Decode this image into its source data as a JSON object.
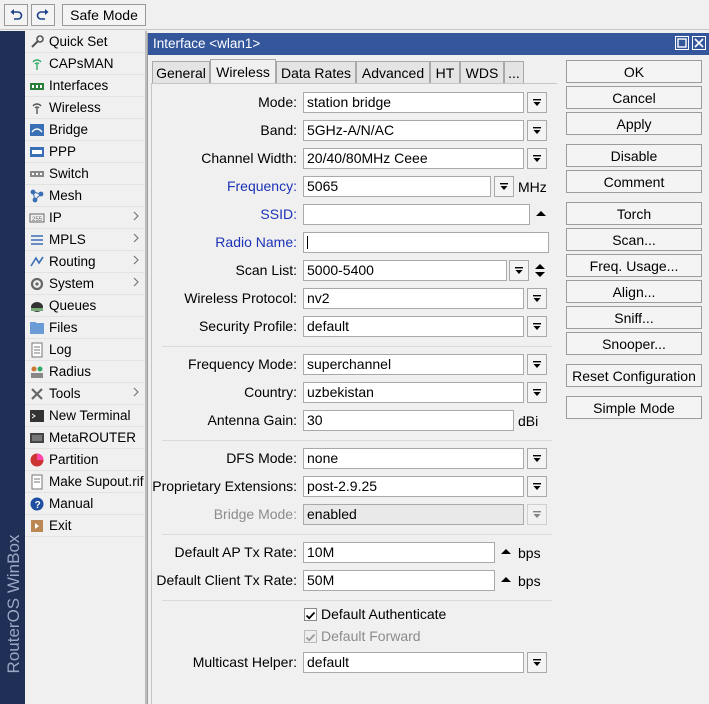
{
  "toolbar": {
    "undo_icon": "undo-icon",
    "redo_icon": "redo-icon",
    "safe_mode": "Safe Mode"
  },
  "brand": "RouterOS WinBox",
  "menu": [
    {
      "label": "Quick Set",
      "icon": "quick-set-icon",
      "submenu": false
    },
    {
      "label": "CAPsMAN",
      "icon": "capsman-icon",
      "submenu": false
    },
    {
      "label": "Interfaces",
      "icon": "interfaces-icon",
      "submenu": false
    },
    {
      "label": "Wireless",
      "icon": "wireless-icon",
      "submenu": false
    },
    {
      "label": "Bridge",
      "icon": "bridge-icon",
      "submenu": false
    },
    {
      "label": "PPP",
      "icon": "ppp-icon",
      "submenu": false
    },
    {
      "label": "Switch",
      "icon": "switch-icon",
      "submenu": false
    },
    {
      "label": "Mesh",
      "icon": "mesh-icon",
      "submenu": false
    },
    {
      "label": "IP",
      "icon": "ip-icon",
      "submenu": true
    },
    {
      "label": "MPLS",
      "icon": "mpls-icon",
      "submenu": true
    },
    {
      "label": "Routing",
      "icon": "routing-icon",
      "submenu": true
    },
    {
      "label": "System",
      "icon": "system-icon",
      "submenu": true
    },
    {
      "label": "Queues",
      "icon": "queues-icon",
      "submenu": false
    },
    {
      "label": "Files",
      "icon": "files-icon",
      "submenu": false
    },
    {
      "label": "Log",
      "icon": "log-icon",
      "submenu": false
    },
    {
      "label": "Radius",
      "icon": "radius-icon",
      "submenu": false
    },
    {
      "label": "Tools",
      "icon": "tools-icon",
      "submenu": true
    },
    {
      "label": "New Terminal",
      "icon": "terminal-icon",
      "submenu": false
    },
    {
      "label": "MetaROUTER",
      "icon": "metarouter-icon",
      "submenu": false
    },
    {
      "label": "Partition",
      "icon": "partition-icon",
      "submenu": false
    },
    {
      "label": "Make Supout.rif",
      "icon": "supout-icon",
      "submenu": false
    },
    {
      "label": "Manual",
      "icon": "manual-icon",
      "submenu": false
    },
    {
      "label": "Exit",
      "icon": "exit-icon",
      "submenu": false
    }
  ],
  "window": {
    "title": "Interface <wlan1>",
    "tabs": [
      "General",
      "Wireless",
      "Data Rates",
      "Advanced",
      "HT",
      "WDS",
      "..."
    ],
    "active_tab": 1
  },
  "form": {
    "mode": {
      "label": "Mode:",
      "value": "station bridge"
    },
    "band": {
      "label": "Band:",
      "value": "5GHz-A/N/AC"
    },
    "channel_width": {
      "label": "Channel Width:",
      "value": "20/40/80MHz Ceee"
    },
    "frequency": {
      "label": "Frequency:",
      "value": "5065",
      "unit": "MHz"
    },
    "ssid": {
      "label": "SSID:",
      "value": ""
    },
    "radio_name": {
      "label": "Radio Name:",
      "value": ""
    },
    "scan_list": {
      "label": "Scan List:",
      "value": "5000-5400"
    },
    "wireless_protocol": {
      "label": "Wireless Protocol:",
      "value": "nv2"
    },
    "security_profile": {
      "label": "Security Profile:",
      "value": "default"
    },
    "frequency_mode": {
      "label": "Frequency Mode:",
      "value": "superchannel"
    },
    "country": {
      "label": "Country:",
      "value": "uzbekistan"
    },
    "antenna_gain": {
      "label": "Antenna Gain:",
      "value": "30",
      "unit": "dBi"
    },
    "dfs_mode": {
      "label": "DFS Mode:",
      "value": "none"
    },
    "proprietary_extensions": {
      "label": "Proprietary Extensions:",
      "value": "post-2.9.25"
    },
    "bridge_mode": {
      "label": "Bridge Mode:",
      "value": "enabled"
    },
    "default_ap_tx_rate": {
      "label": "Default AP Tx Rate:",
      "value": "10M",
      "unit": "bps"
    },
    "default_client_tx_rate": {
      "label": "Default Client Tx Rate:",
      "value": "50M",
      "unit": "bps"
    },
    "default_authenticate": {
      "label": "Default Authenticate",
      "checked": true
    },
    "default_forward": {
      "label": "Default Forward",
      "checked": true,
      "disabled": true
    },
    "multicast_helper": {
      "label": "Multicast Helper:",
      "value": "default"
    }
  },
  "buttons": [
    "OK",
    "Cancel",
    "Apply",
    "Disable",
    "Comment",
    "Torch",
    "Scan...",
    "Freq. Usage...",
    "Align...",
    "Sniff...",
    "Snooper...",
    "Reset Configuration",
    "Simple Mode"
  ],
  "colors": {
    "titlebar": "#34579c",
    "side_brand": "#1f2f55",
    "link_label": "#1c33b8"
  }
}
